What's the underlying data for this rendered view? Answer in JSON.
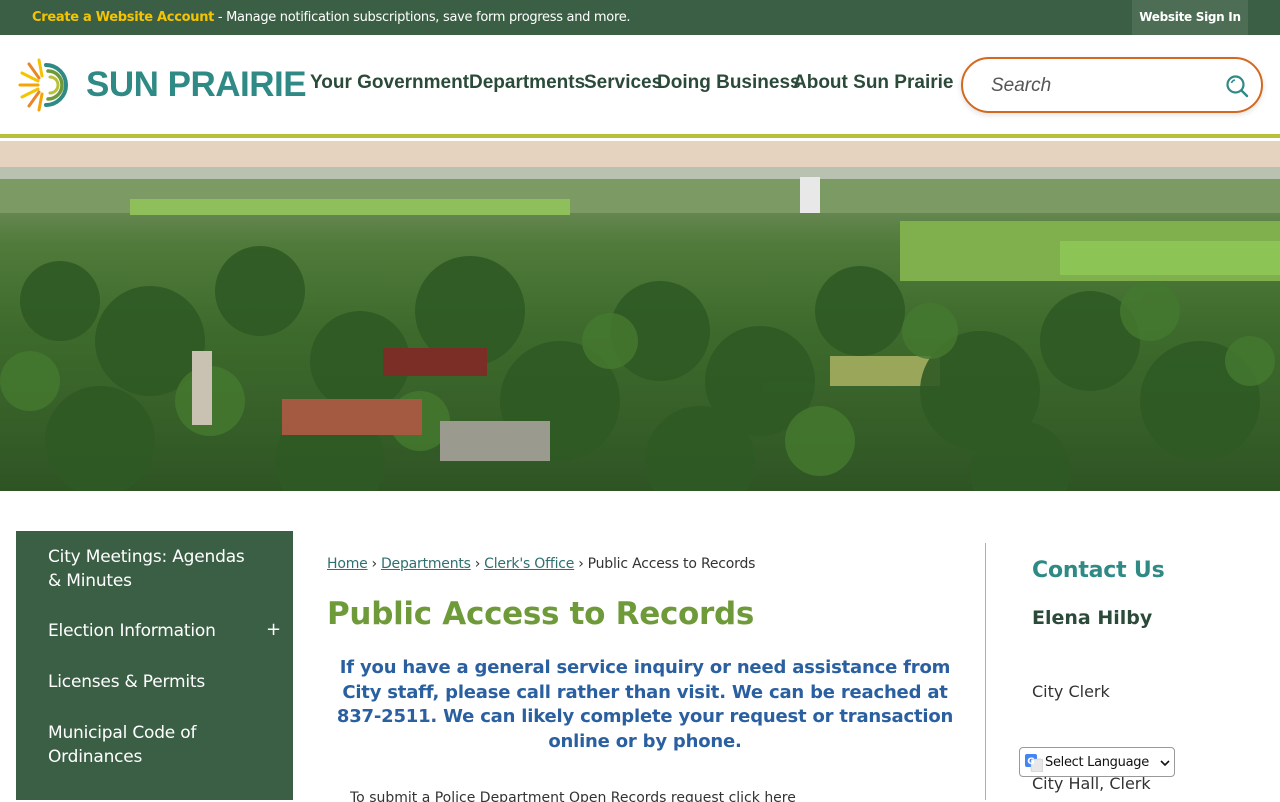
{
  "topbar": {
    "create_account_link": "Create a Website Account",
    "notice_text": " - Manage notification subscriptions, save form progress and more.",
    "signin_button": "Website Sign In"
  },
  "header": {
    "logo_text": "SUN PRAIRIE",
    "nav": [
      {
        "label": "Your Government"
      },
      {
        "label": "Departments"
      },
      {
        "label": "Services"
      },
      {
        "label": "Doing Business"
      },
      {
        "label": "About Sun Prairie"
      }
    ],
    "search_placeholder": "Search"
  },
  "sidebar": {
    "items": [
      {
        "label": "City Meetings: Agendas\n& Minutes"
      },
      {
        "label": "Election Information",
        "expand": "+"
      },
      {
        "label": "Licenses & Permits"
      },
      {
        "label": "Municipal Code of\nOrdinances"
      }
    ]
  },
  "breadcrumb": {
    "home": "Home",
    "departments": "Departments",
    "clerks_office": "Clerk's Office",
    "current": "Public Access to Records",
    "separator": "›"
  },
  "main": {
    "title": "Public Access to Records",
    "notice": "If you have a general service inquiry or need assistance from City staff, please call rather than visit. We can be reached at 837-2511. We can likely complete your request or transaction online or by phone.",
    "cutoff_line": "To submit a Police Department Open Records request click here"
  },
  "contact": {
    "heading": "Contact Us",
    "name": "Elena Hilby",
    "role": "City Clerk",
    "department": "City Hall, Clerk"
  },
  "translate": {
    "label": "Select Language"
  },
  "colors": {
    "topbar_green": "#3b5f45",
    "accent_yellow": "#f5c400",
    "teal": "#2f8a86",
    "title_green": "#6f9a3a",
    "search_border": "#d3691f",
    "notice_blue": "#2a5fa0"
  }
}
